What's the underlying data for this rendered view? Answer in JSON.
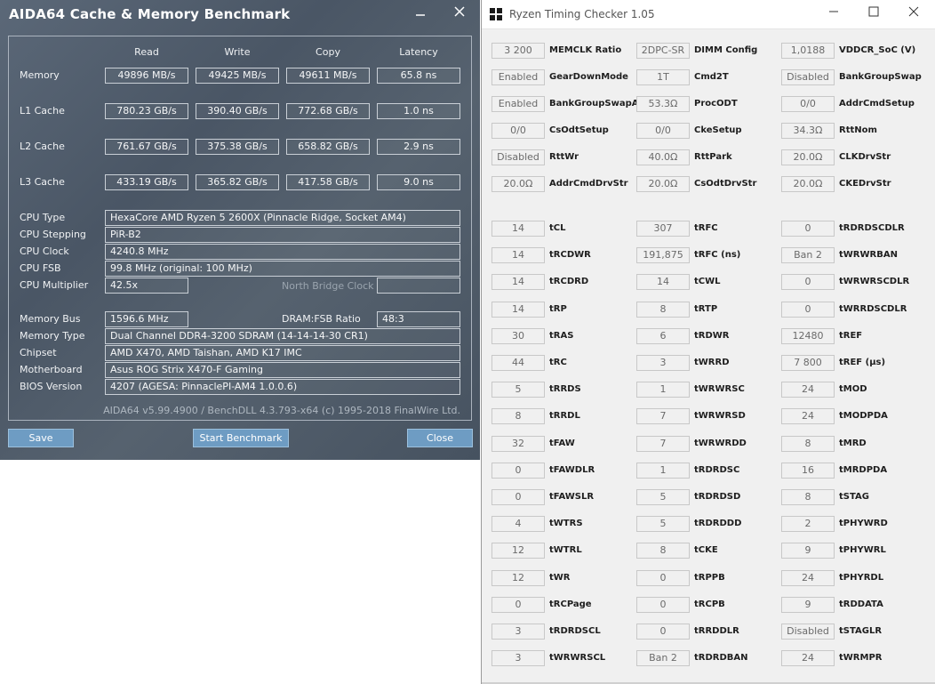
{
  "aida": {
    "title": "AIDA64 Cache & Memory Benchmark",
    "col_headers": [
      "Read",
      "Write",
      "Copy",
      "Latency"
    ],
    "rows": [
      {
        "label": "Memory",
        "values": [
          "49896 MB/s",
          "49425 MB/s",
          "49611 MB/s",
          "65.8 ns"
        ]
      },
      {
        "label": "L1 Cache",
        "values": [
          "780.23 GB/s",
          "390.40 GB/s",
          "772.68 GB/s",
          "1.0 ns"
        ]
      },
      {
        "label": "L2 Cache",
        "values": [
          "761.67 GB/s",
          "375.38 GB/s",
          "658.82 GB/s",
          "2.9 ns"
        ]
      },
      {
        "label": "L3 Cache",
        "values": [
          "433.19 GB/s",
          "365.82 GB/s",
          "417.58 GB/s",
          "9.0 ns"
        ]
      }
    ],
    "info1": [
      {
        "label": "CPU Type",
        "value": "HexaCore AMD Ryzen 5 2600X  (Pinnacle Ridge, Socket AM4)"
      },
      {
        "label": "CPU Stepping",
        "value": "PiR-B2"
      },
      {
        "label": "CPU Clock",
        "value": "4240.8 MHz"
      },
      {
        "label": "CPU FSB",
        "value": "99.8 MHz  (original: 100 MHz)"
      }
    ],
    "cpu_multiplier": {
      "label": "CPU Multiplier",
      "value": "42.5x",
      "nb_label": "North Bridge Clock",
      "nb_value": ""
    },
    "memory_bus": {
      "label": "Memory Bus",
      "value": "1596.6 MHz",
      "ratio_label": "DRAM:FSB Ratio",
      "ratio_value": "48:3"
    },
    "info2": [
      {
        "label": "Memory Type",
        "value": "Dual Channel DDR4-3200 SDRAM  (14-14-14-30 CR1)"
      },
      {
        "label": "Chipset",
        "value": "AMD X470, AMD Taishan, AMD K17 IMC"
      },
      {
        "label": "Motherboard",
        "value": "Asus ROG Strix X470-F Gaming"
      },
      {
        "label": "BIOS Version",
        "value": "4207  (AGESA: PinnaclePI-AM4 1.0.0.6)"
      }
    ],
    "footer": "AIDA64 v5.99.4900 / BenchDLL 4.3.793-x64  (c) 1995-2018 FinalWire Ltd.",
    "buttons": {
      "save": "Save",
      "start": "Start Benchmark",
      "close": "Close"
    }
  },
  "rtc": {
    "title": "Ryzen Timing Checker 1.05",
    "section1": [
      [
        {
          "value": "3 200",
          "label": "MEMCLK Ratio"
        },
        {
          "value": "2DPC-SR",
          "label": "DIMM Config"
        },
        {
          "value": "1,0188",
          "label": "VDDCR_SoC (V)"
        }
      ],
      [
        {
          "value": "Enabled",
          "label": "GearDownMode"
        },
        {
          "value": "1T",
          "label": "Cmd2T"
        },
        {
          "value": "Disabled",
          "label": "BankGroupSwap"
        }
      ],
      [
        {
          "value": "Enabled",
          "label": "BankGroupSwapAlt"
        },
        {
          "value": "53.3Ω",
          "label": "ProcODT"
        },
        {
          "value": "0/0",
          "label": "AddrCmdSetup"
        }
      ],
      [
        {
          "value": "0/0",
          "label": "CsOdtSetup"
        },
        {
          "value": "0/0",
          "label": "CkeSetup"
        },
        {
          "value": "34.3Ω",
          "label": "RttNom"
        }
      ],
      [
        {
          "value": "Disabled",
          "label": "RttWr"
        },
        {
          "value": "40.0Ω",
          "label": "RttPark"
        },
        {
          "value": "20.0Ω",
          "label": "CLKDrvStr"
        }
      ],
      [
        {
          "value": "20.0Ω",
          "label": "AddrCmdDrvStr"
        },
        {
          "value": "20.0Ω",
          "label": "CsOdtDrvStr"
        },
        {
          "value": "20.0Ω",
          "label": "CKEDrvStr"
        }
      ]
    ],
    "section2": [
      [
        {
          "value": "14",
          "label": "tCL"
        },
        {
          "value": "307",
          "label": "tRFC"
        },
        {
          "value": "0",
          "label": "tRDRDSCDLR"
        }
      ],
      [
        {
          "value": "14",
          "label": "tRCDWR"
        },
        {
          "value": "191,875",
          "label": "tRFC (ns)"
        },
        {
          "value": "Ban 2",
          "label": "tWRWRBAN"
        }
      ],
      [
        {
          "value": "14",
          "label": "tRCDRD"
        },
        {
          "value": "14",
          "label": "tCWL"
        },
        {
          "value": "0",
          "label": "tWRWRSCDLR"
        }
      ],
      [
        {
          "value": "14",
          "label": "tRP"
        },
        {
          "value": "8",
          "label": "tRTP"
        },
        {
          "value": "0",
          "label": "tWRRDSCDLR"
        }
      ],
      [
        {
          "value": "30",
          "label": "tRAS"
        },
        {
          "value": "6",
          "label": "tRDWR"
        },
        {
          "value": "12480",
          "label": "tREF"
        }
      ],
      [
        {
          "value": "44",
          "label": "tRC"
        },
        {
          "value": "3",
          "label": "tWRRD"
        },
        {
          "value": "7 800",
          "label": "tREF (µs)"
        }
      ],
      [
        {
          "value": "5",
          "label": "tRRDS"
        },
        {
          "value": "1",
          "label": "tWRWRSC"
        },
        {
          "value": "24",
          "label": "tMOD"
        }
      ],
      [
        {
          "value": "8",
          "label": "tRRDL"
        },
        {
          "value": "7",
          "label": "tWRWRSD"
        },
        {
          "value": "24",
          "label": "tMODPDA"
        }
      ],
      [
        {
          "value": "32",
          "label": "tFAW"
        },
        {
          "value": "7",
          "label": "tWRWRDD"
        },
        {
          "value": "8",
          "label": "tMRD"
        }
      ],
      [
        {
          "value": "0",
          "label": "tFAWDLR"
        },
        {
          "value": "1",
          "label": "tRDRDSC"
        },
        {
          "value": "16",
          "label": "tMRDPDA"
        }
      ],
      [
        {
          "value": "0",
          "label": "tFAWSLR"
        },
        {
          "value": "5",
          "label": "tRDRDSD"
        },
        {
          "value": "8",
          "label": "tSTAG"
        }
      ],
      [
        {
          "value": "4",
          "label": "tWTRS"
        },
        {
          "value": "5",
          "label": "tRDRDDD"
        },
        {
          "value": "2",
          "label": "tPHYWRD"
        }
      ],
      [
        {
          "value": "12",
          "label": "tWTRL"
        },
        {
          "value": "8",
          "label": "tCKE"
        },
        {
          "value": "9",
          "label": "tPHYWRL"
        }
      ],
      [
        {
          "value": "12",
          "label": "tWR"
        },
        {
          "value": "0",
          "label": "tRPPB"
        },
        {
          "value": "24",
          "label": "tPHYRDL"
        }
      ],
      [
        {
          "value": "0",
          "label": "tRCPage"
        },
        {
          "value": "0",
          "label": "tRCPB"
        },
        {
          "value": "9",
          "label": "tRDDATA"
        }
      ],
      [
        {
          "value": "3",
          "label": "tRDRDSCL"
        },
        {
          "value": "0",
          "label": "tRRDDLR"
        },
        {
          "value": "Disabled",
          "label": "tSTAGLR"
        }
      ],
      [
        {
          "value": "3",
          "label": "tWRWRSCL"
        },
        {
          "value": "Ban 2",
          "label": "tRDRDBAN"
        },
        {
          "value": "24",
          "label": "tWRMPR"
        }
      ]
    ]
  }
}
